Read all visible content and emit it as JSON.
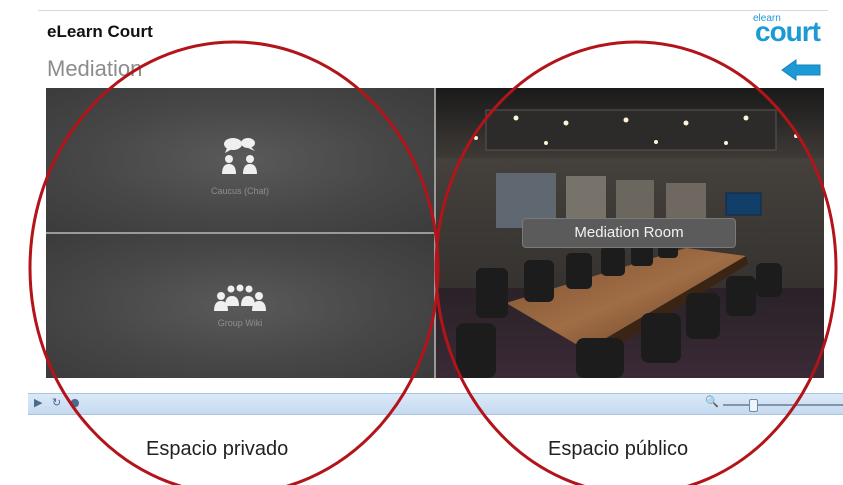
{
  "header": {
    "app_title": "eLearn Court",
    "page_title": "Mediation",
    "logo_small": "elearn",
    "logo_big": "court"
  },
  "tiles": {
    "caucus_label": "Caucus (Chat)",
    "wiki_label": "Group Wiki",
    "room_label": "Mediation Room"
  },
  "player": {
    "zoom_level": 0.25
  },
  "captions": {
    "left": "Espacio privado",
    "right": "Espacio público"
  },
  "colors": {
    "accent_blue": "#1d9ad6",
    "annotation_red": "#b2141a",
    "tile_gray": "#474747"
  },
  "icons": [
    "play-icon",
    "refresh-icon",
    "settings-icon",
    "zoom-icon",
    "back-arrow-icon",
    "chat-people-icon",
    "group-people-icon"
  ]
}
